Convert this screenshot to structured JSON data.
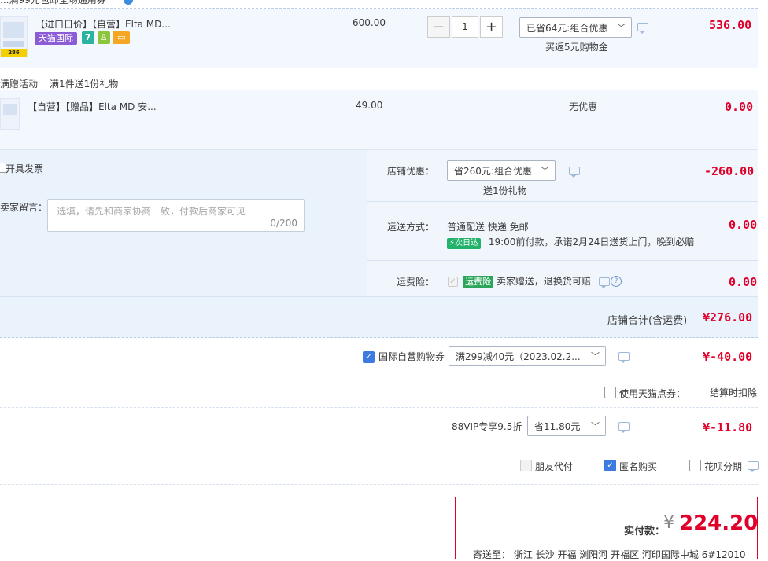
{
  "top_partial": "...满99元包邮全场通用券",
  "item1": {
    "title": "【进口日价】【自营】Elta MD...",
    "badge": "天猫国际",
    "thumb_tag": "286",
    "price": "600.00",
    "qty": "1",
    "promo_select": "已省64元:组合优惠",
    "promo_note": "买返5元购物金",
    "amount": "536.00",
    "icons": [
      "seven-day-return-icon",
      "guarantee-icon",
      "card-icon"
    ]
  },
  "gift": {
    "label": "满赠活动",
    "desc": "满1件送1份礼物"
  },
  "item2": {
    "title": "【自营】【赠品】Elta MD 安...",
    "price": "49.00",
    "promo": "无优惠",
    "amount": "0.00"
  },
  "shop": {
    "invoice_label": "开具发票",
    "message_label": "卖家留言：",
    "message_placeholder": "选填，请先和商家协商一致，付款后商家可见",
    "message_count": "0/200",
    "discount_label": "店铺优惠：",
    "discount_select": "省260元:组合优惠",
    "discount_note": "送1份礼物",
    "discount_amount": "-260.00",
    "delivery_label": "运送方式：",
    "delivery_value": "普通配送 快递 免邮",
    "nextday_badge": "次日达",
    "delivery_promise": "19:00前付款，承诺2月24日送货上门，晚到必赔",
    "delivery_amount": "0.00",
    "insurance_label": "运费险：",
    "insurance_tag": "运费险",
    "insurance_text": "卖家赠送，退换货可赔",
    "insurance_amount": "0.00",
    "total_label": "店铺合计(含运费)",
    "total_amount": "¥276.00"
  },
  "coupon": {
    "label": "国际自营购物券",
    "select": "满299减40元（2023.02.2...",
    "amount": "¥-40.00"
  },
  "points": {
    "label": "使用天猫点券：",
    "note": "结算时扣除"
  },
  "vip": {
    "label": "88VIP专享9.5折",
    "select": "省11.80元",
    "amount": "¥-11.80"
  },
  "options": {
    "friend_pay": "朋友代付",
    "anonymous": "匿名购买",
    "huabei": "花呗分期"
  },
  "summary": {
    "label": "实付款：",
    "currency": "¥",
    "amount": "224.20",
    "address_partial": "寄送至：  浙江 长沙 开福 浏阳河 开福区 河印国际中城 6#12010"
  },
  "colors": {
    "accent_red": "#e0002a",
    "panel_blue": "#eaf2fc",
    "checkbox_blue": "#3d7be0",
    "tmall_purple": "#8b5cd6"
  }
}
